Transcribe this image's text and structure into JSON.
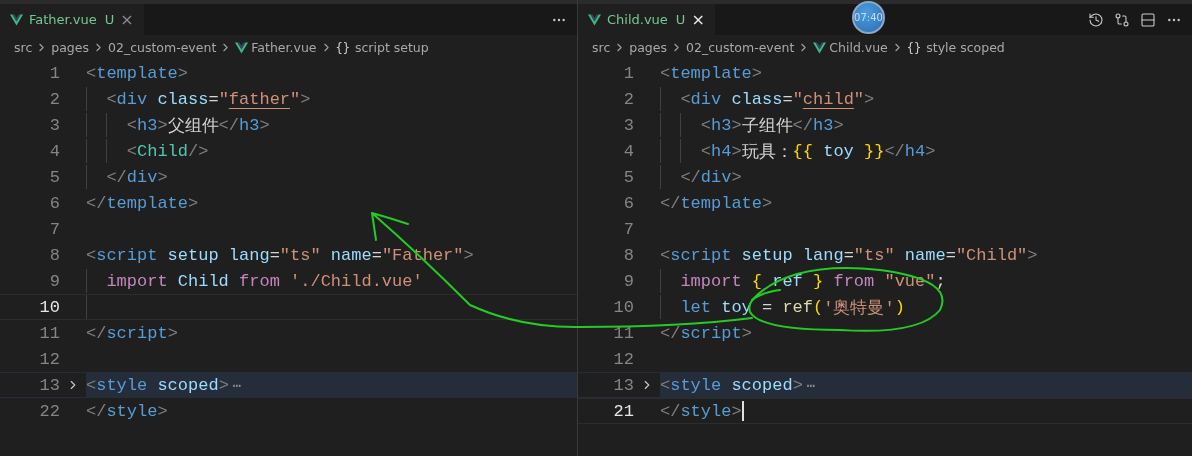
{
  "panes": [
    {
      "tab": {
        "file": "Father.vue",
        "status": "U",
        "close": "×",
        "focused": false
      },
      "breadcrumb": [
        {
          "kind": "folder",
          "label": "src"
        },
        {
          "kind": "folder",
          "label": "pages"
        },
        {
          "kind": "folder",
          "label": "02_custom-event"
        },
        {
          "kind": "file",
          "label": "Father.vue"
        },
        {
          "kind": "symbol",
          "label": "script setup",
          "symbol": "{}"
        }
      ],
      "actions": [
        {
          "kind": "more"
        }
      ],
      "lines": [
        {
          "number": "1",
          "current": false,
          "folded": false,
          "tokens": [
            {
              "kind": "punct",
              "text": "<"
            },
            {
              "kind": "tag",
              "text": "template"
            },
            {
              "kind": "punct",
              "text": ">"
            }
          ],
          "children": [
            {
              "number": "2",
              "current": false,
              "folded": false,
              "tokens": [
                {
                  "kind": "punct",
                  "text": "<"
                },
                {
                  "kind": "tag",
                  "text": "div"
                },
                {
                  "kind": "attr",
                  "text": " class"
                },
                {
                  "kind": "text",
                  "text": "="
                },
                {
                  "kind": "string",
                  "text": "\""
                },
                {
                  "kind": "string",
                  "text": "father",
                  "underlined": true
                },
                {
                  "kind": "string",
                  "text": "\""
                },
                {
                  "kind": "punct",
                  "text": ">"
                }
              ],
              "children": [
                {
                  "number": "3",
                  "current": false,
                  "folded": false,
                  "tokens": [
                    {
                      "kind": "punct",
                      "text": "<"
                    },
                    {
                      "kind": "tag",
                      "text": "h3"
                    },
                    {
                      "kind": "punct",
                      "text": ">"
                    },
                    {
                      "kind": "text",
                      "text": "父组件"
                    },
                    {
                      "kind": "punct",
                      "text": "</"
                    },
                    {
                      "kind": "tag",
                      "text": "h3"
                    },
                    {
                      "kind": "punct",
                      "text": ">"
                    }
                  ]
                },
                {
                  "number": "4",
                  "current": false,
                  "folded": false,
                  "tokens": [
                    {
                      "kind": "punct",
                      "text": "<"
                    },
                    {
                      "kind": "component",
                      "text": "Child"
                    },
                    {
                      "kind": "punct",
                      "text": "/>"
                    }
                  ]
                }
              ]
            },
            {
              "number": "5",
              "current": false,
              "folded": false,
              "tokens": [
                {
                  "kind": "punct",
                  "text": "</"
                },
                {
                  "kind": "tag",
                  "text": "div"
                },
                {
                  "kind": "punct",
                  "text": ">"
                }
              ]
            }
          ]
        },
        {
          "number": "6",
          "current": false,
          "folded": false,
          "tokens": [
            {
              "kind": "punct",
              "text": "</"
            },
            {
              "kind": "tag",
              "text": "template"
            },
            {
              "kind": "punct",
              "text": ">"
            }
          ]
        },
        {
          "number": "7",
          "current": false,
          "folded": false
        },
        {
          "number": "8",
          "current": false,
          "folded": false,
          "tokens": [
            {
              "kind": "punct",
              "text": "<"
            },
            {
              "kind": "tag",
              "text": "script"
            },
            {
              "kind": "attr",
              "text": " setup"
            },
            {
              "kind": "attr",
              "text": " lang"
            },
            {
              "kind": "text",
              "text": "="
            },
            {
              "kind": "string",
              "text": "\"ts\""
            },
            {
              "kind": "attr",
              "text": " name"
            },
            {
              "kind": "text",
              "text": "="
            },
            {
              "kind": "string",
              "text": "\"Father\""
            },
            {
              "kind": "punct",
              "text": ">"
            }
          ],
          "children": [
            {
              "number": "9",
              "current": false,
              "folded": false,
              "tokens": [
                {
                  "kind": "keyword",
                  "text": "import"
                },
                {
                  "kind": "variable",
                  "text": " Child"
                },
                {
                  "kind": "keyword",
                  "text": " from"
                },
                {
                  "kind": "string",
                  "text": " './Child.vue'"
                }
              ]
            },
            {
              "number": "10",
              "current": true,
              "folded": false
            }
          ]
        },
        {
          "number": "11",
          "current": false,
          "folded": false,
          "tokens": [
            {
              "kind": "punct",
              "text": "</"
            },
            {
              "kind": "tag",
              "text": "script"
            },
            {
              "kind": "punct",
              "text": ">"
            }
          ]
        },
        {
          "number": "12",
          "current": false,
          "folded": false
        },
        {
          "number": "13",
          "current": false,
          "folded": true,
          "fold_mark": "⋯",
          "tokens": [
            {
              "kind": "punct",
              "text": "<"
            },
            {
              "kind": "tag",
              "text": "style"
            },
            {
              "kind": "attr",
              "text": " scoped"
            },
            {
              "kind": "punct",
              "text": ">"
            }
          ]
        },
        {
          "number": "22",
          "current": false,
          "folded": false,
          "tokens": [
            {
              "kind": "punct",
              "text": "</"
            },
            {
              "kind": "tag",
              "text": "style"
            },
            {
              "kind": "punct",
              "text": ">"
            }
          ]
        }
      ]
    },
    {
      "tab": {
        "file": "Child.vue",
        "status": "U",
        "close": "×",
        "focused": true
      },
      "breadcrumb": [
        {
          "kind": "folder",
          "label": "src"
        },
        {
          "kind": "folder",
          "label": "pages"
        },
        {
          "kind": "folder",
          "label": "02_custom-event"
        },
        {
          "kind": "file",
          "label": "Child.vue"
        },
        {
          "kind": "symbol",
          "label": "style scoped",
          "symbol": "{}"
        }
      ],
      "actions": [
        {
          "kind": "history"
        },
        {
          "kind": "compare"
        },
        {
          "kind": "split"
        },
        {
          "kind": "more"
        }
      ],
      "lines": [
        {
          "number": "1",
          "current": false,
          "folded": false,
          "tokens": [
            {
              "kind": "punct",
              "text": "<"
            },
            {
              "kind": "tag",
              "text": "template"
            },
            {
              "kind": "punct",
              "text": ">"
            }
          ],
          "children": [
            {
              "number": "2",
              "current": false,
              "folded": false,
              "tokens": [
                {
                  "kind": "punct",
                  "text": "<"
                },
                {
                  "kind": "tag",
                  "text": "div"
                },
                {
                  "kind": "attr",
                  "text": " class"
                },
                {
                  "kind": "text",
                  "text": "="
                },
                {
                  "kind": "string",
                  "text": "\""
                },
                {
                  "kind": "string",
                  "text": "child",
                  "underlined": true
                },
                {
                  "kind": "string",
                  "text": "\""
                },
                {
                  "kind": "punct",
                  "text": ">"
                }
              ],
              "children": [
                {
                  "number": "3",
                  "current": false,
                  "folded": false,
                  "tokens": [
                    {
                      "kind": "punct",
                      "text": "<"
                    },
                    {
                      "kind": "tag",
                      "text": "h3"
                    },
                    {
                      "kind": "punct",
                      "text": ">"
                    },
                    {
                      "kind": "text",
                      "text": "子组件"
                    },
                    {
                      "kind": "punct",
                      "text": "</"
                    },
                    {
                      "kind": "tag",
                      "text": "h3"
                    },
                    {
                      "kind": "punct",
                      "text": ">"
                    }
                  ]
                },
                {
                  "number": "4",
                  "current": false,
                  "folded": false,
                  "tokens": [
                    {
                      "kind": "punct",
                      "text": "<"
                    },
                    {
                      "kind": "tag",
                      "text": "h4"
                    },
                    {
                      "kind": "punct",
                      "text": ">"
                    },
                    {
                      "kind": "text",
                      "text": "玩具："
                    },
                    {
                      "kind": "brace",
                      "text": "{{"
                    },
                    {
                      "kind": "variable",
                      "text": " toy "
                    },
                    {
                      "kind": "brace",
                      "text": "}}"
                    },
                    {
                      "kind": "punct",
                      "text": "</"
                    },
                    {
                      "kind": "tag",
                      "text": "h4"
                    },
                    {
                      "kind": "punct",
                      "text": ">"
                    }
                  ]
                }
              ]
            },
            {
              "number": "5",
              "current": false,
              "folded": false,
              "tokens": [
                {
                  "kind": "punct",
                  "text": "</"
                },
                {
                  "kind": "tag",
                  "text": "div"
                },
                {
                  "kind": "punct",
                  "text": ">"
                }
              ]
            }
          ]
        },
        {
          "number": "6",
          "current": false,
          "folded": false,
          "tokens": [
            {
              "kind": "punct",
              "text": "</"
            },
            {
              "kind": "tag",
              "text": "template"
            },
            {
              "kind": "punct",
              "text": ">"
            }
          ]
        },
        {
          "number": "7",
          "current": false,
          "folded": false
        },
        {
          "number": "8",
          "current": false,
          "folded": false,
          "tokens": [
            {
              "kind": "punct",
              "text": "<"
            },
            {
              "kind": "tag",
              "text": "script"
            },
            {
              "kind": "attr",
              "text": " setup"
            },
            {
              "kind": "attr",
              "text": " lang"
            },
            {
              "kind": "text",
              "text": "="
            },
            {
              "kind": "string",
              "text": "\"ts\""
            },
            {
              "kind": "attr",
              "text": " name"
            },
            {
              "kind": "text",
              "text": "="
            },
            {
              "kind": "string",
              "text": "\"Child\""
            },
            {
              "kind": "punct",
              "text": ">"
            }
          ],
          "children": [
            {
              "number": "9",
              "current": false,
              "folded": false,
              "tokens": [
                {
                  "kind": "keyword",
                  "text": "import"
                },
                {
                  "kind": "brace",
                  "text": " {"
                },
                {
                  "kind": "variable",
                  "text": " ref "
                },
                {
                  "kind": "brace",
                  "text": "}"
                },
                {
                  "kind": "keyword",
                  "text": " from"
                },
                {
                  "kind": "string",
                  "text": " \"vue\""
                },
                {
                  "kind": "text",
                  "text": ";"
                }
              ]
            },
            {
              "number": "10",
              "current": false,
              "folded": false,
              "tokens": [
                {
                  "kind": "storage",
                  "text": "let"
                },
                {
                  "kind": "variable",
                  "text": " toy"
                },
                {
                  "kind": "text",
                  "text": " ="
                },
                {
                  "kind": "function",
                  "text": " ref"
                },
                {
                  "kind": "brace",
                  "text": "("
                },
                {
                  "kind": "string",
                  "text": "'奥特曼'"
                },
                {
                  "kind": "brace",
                  "text": ")"
                }
              ]
            }
          ]
        },
        {
          "number": "11",
          "current": false,
          "folded": false,
          "tokens": [
            {
              "kind": "punct",
              "text": "</"
            },
            {
              "kind": "tag",
              "text": "script"
            },
            {
              "kind": "punct",
              "text": ">"
            }
          ]
        },
        {
          "number": "12",
          "current": false,
          "folded": false
        },
        {
          "number": "13",
          "current": false,
          "folded": true,
          "fold_mark": "⋯",
          "tokens": [
            {
              "kind": "punct",
              "text": "<"
            },
            {
              "kind": "tag",
              "text": "style"
            },
            {
              "kind": "attr",
              "text": " scoped"
            },
            {
              "kind": "punct",
              "text": ">"
            }
          ]
        },
        {
          "number": "21",
          "current": true,
          "folded": false,
          "tokens": [
            {
              "kind": "punct",
              "text": "</"
            },
            {
              "kind": "tag",
              "text": "style"
            },
            {
              "kind": "punct",
              "text": ">"
            }
          ]
        }
      ]
    }
  ],
  "timer_badge": "07:40"
}
